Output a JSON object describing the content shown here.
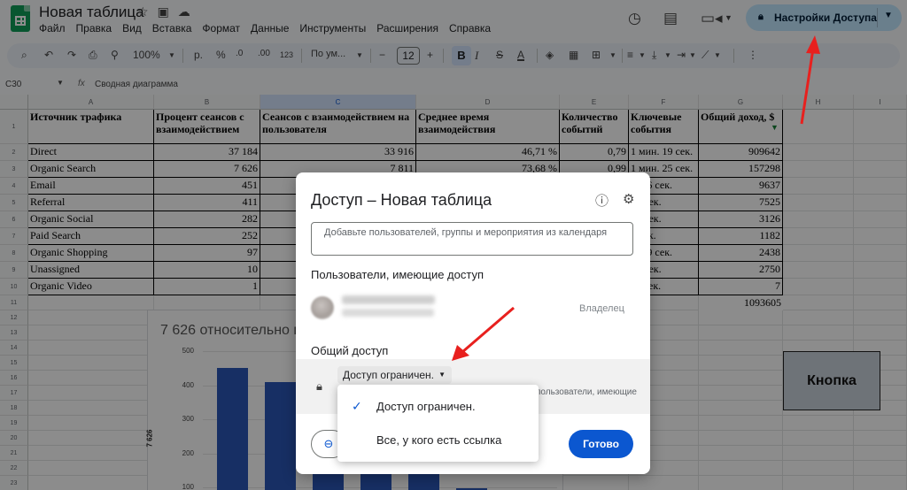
{
  "header": {
    "doc_title": "Новая таблица",
    "menu": [
      "Файл",
      "Правка",
      "Вид",
      "Вставка",
      "Формат",
      "Данные",
      "Инструменты",
      "Расширения",
      "Справка"
    ],
    "share_button": "Настройки Доступа"
  },
  "toolbar": {
    "zoom": "100%",
    "currency": "р.",
    "percent": "%",
    "dec_less": ".0",
    "dec_more": ".00",
    "num_format": "123",
    "font": "По ум...",
    "font_size": "12",
    "bold": "B",
    "italic": "I",
    "strike": "S",
    "text_color": "A"
  },
  "formula_bar": {
    "cell_ref": "C30",
    "fx": "fx",
    "value": "Сводная диаграмма"
  },
  "columns": [
    "A",
    "B",
    "C",
    "D",
    "E",
    "F",
    "G",
    "H",
    "I"
  ],
  "rows": [
    "1",
    "2",
    "3",
    "4",
    "5",
    "6",
    "7",
    "8",
    "9",
    "10",
    "11",
    "12",
    "13",
    "14",
    "15",
    "16",
    "17",
    "18",
    "19",
    "20",
    "21",
    "22",
    "23"
  ],
  "table": {
    "headers": [
      "Источник трафика",
      "Процент сеансов с взаимодействием",
      "Сеансов с взаимодействием на пользователя",
      "Среднее время взаимодействия",
      "Количество событий",
      "Ключевые события",
      "Общий доход, $"
    ],
    "rows": [
      [
        "Direct",
        "37 184",
        "33 916",
        "46,71 %",
        "0,79",
        "1 мин. 19 сек.",
        "909642"
      ],
      [
        "Organic Search",
        "7 626",
        "7 811",
        "73,68 %",
        "0,99",
        "1 мин. 25 сек.",
        "157298"
      ],
      [
        "Email",
        "451",
        "",
        "",
        "",
        "н. 16 сек.",
        "9637"
      ],
      [
        "Referral",
        "411",
        "",
        "",
        "",
        "50 сек.",
        "7525"
      ],
      [
        "Organic Social",
        "282",
        "",
        "",
        "",
        "24 сек.",
        "3126"
      ],
      [
        "Paid Search",
        "252",
        "",
        "",
        "",
        "1 сек.",
        "1182"
      ],
      [
        "Organic Shopping",
        "97",
        "",
        "",
        "",
        "н. 49 сек.",
        "2438"
      ],
      [
        "Unassigned",
        "10",
        "",
        "",
        "",
        "36 сек.",
        "2750"
      ],
      [
        "Organic Video",
        "1",
        "",
        "",
        "",
        "11 сек.",
        "7"
      ]
    ],
    "total": "1093605"
  },
  "chart": {
    "title": "7 626 относительно п",
    "y_axis_label": "7 626"
  },
  "chart_data": {
    "type": "bar",
    "title": "7 626 относительно п",
    "ylabel": "7 626",
    "ylim": [
      100,
      500
    ],
    "y_ticks": [
      "500",
      "400",
      "300",
      "200",
      "100"
    ],
    "values": [
      450,
      408,
      300,
      210,
      160,
      97
    ]
  },
  "sheet_button": "Кнопка",
  "dialog": {
    "title": "Доступ – Новая таблица",
    "add_placeholder": "Добавьте пользователей, группы и мероприятия из календаря",
    "people_label": "Пользователи, имеющие доступ",
    "owner_role": "Владелец",
    "general_label": "Общий доступ",
    "access_value": "Доступ ограничен.",
    "access_desc": "пользователи, имеющие",
    "done": "Готово"
  },
  "access_menu": {
    "options": [
      "Доступ ограничен.",
      "Все, у кого есть ссылка"
    ]
  },
  "colors": {
    "share_bg": "#c2e7ff",
    "primary": "#0b57d0",
    "bar": "#2a57b7",
    "annotation_arrow": "#e8201e"
  }
}
